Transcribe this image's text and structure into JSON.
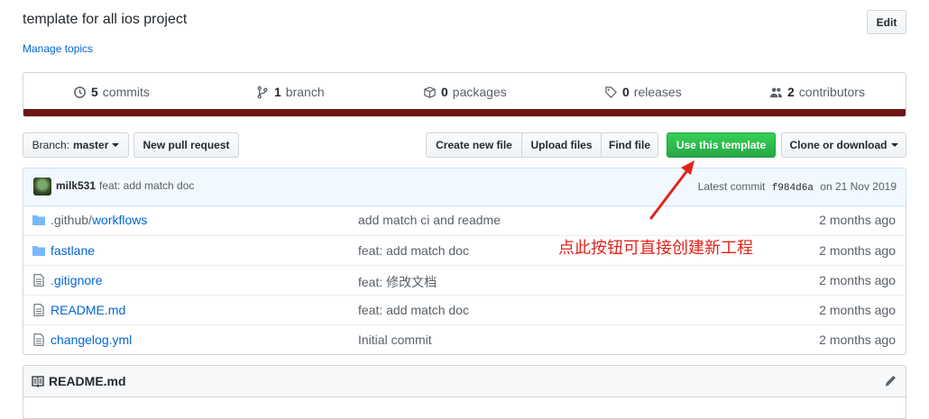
{
  "repo": {
    "description": "template for all ios project",
    "manage_topics": "Manage topics",
    "edit_label": "Edit"
  },
  "stats": {
    "commits": {
      "count": "5",
      "label": "commits"
    },
    "branches": {
      "count": "1",
      "label": "branch"
    },
    "packages": {
      "count": "0",
      "label": "packages"
    },
    "releases": {
      "count": "0",
      "label": "releases"
    },
    "contributors": {
      "count": "2",
      "label": "contributors"
    },
    "language_bar_color": "#701516"
  },
  "toolbar": {
    "branch_prefix": "Branch:",
    "branch_name": "master",
    "new_pull_request": "New pull request",
    "create_new_file": "Create new file",
    "upload_files": "Upload files",
    "find_file": "Find file",
    "use_template": "Use this template",
    "clone_download": "Clone or download"
  },
  "latest_commit": {
    "author": "milk531",
    "message": "feat: add match doc",
    "label": "Latest commit",
    "sha": "f984d6a",
    "date": "on 21 Nov 2019"
  },
  "files": [
    {
      "type": "folder",
      "prefix": ".github/",
      "name": "workflows",
      "message": "add match ci and readme",
      "age": "2 months ago"
    },
    {
      "type": "folder",
      "prefix": "",
      "name": "fastlane",
      "message": "feat: add match doc",
      "age": "2 months ago"
    },
    {
      "type": "file",
      "prefix": "",
      "name": ".gitignore",
      "message": "feat: 修改文档",
      "age": "2 months ago"
    },
    {
      "type": "file",
      "prefix": "",
      "name": "README.md",
      "message": "feat: add match doc",
      "age": "2 months ago"
    },
    {
      "type": "file",
      "prefix": "",
      "name": "changelog.yml",
      "message": "Initial commit",
      "age": "2 months ago"
    }
  ],
  "annotation": {
    "text": "点此按钮可直接创建新工程",
    "color": "#e2231a"
  },
  "readme": {
    "title": "README.md",
    "icons": [
      "book-icon",
      "pencil-icon"
    ]
  },
  "colors": {
    "link": "#0366d6",
    "primary_button": "#28a745",
    "commit_bar_bg": "#f1f8ff"
  }
}
